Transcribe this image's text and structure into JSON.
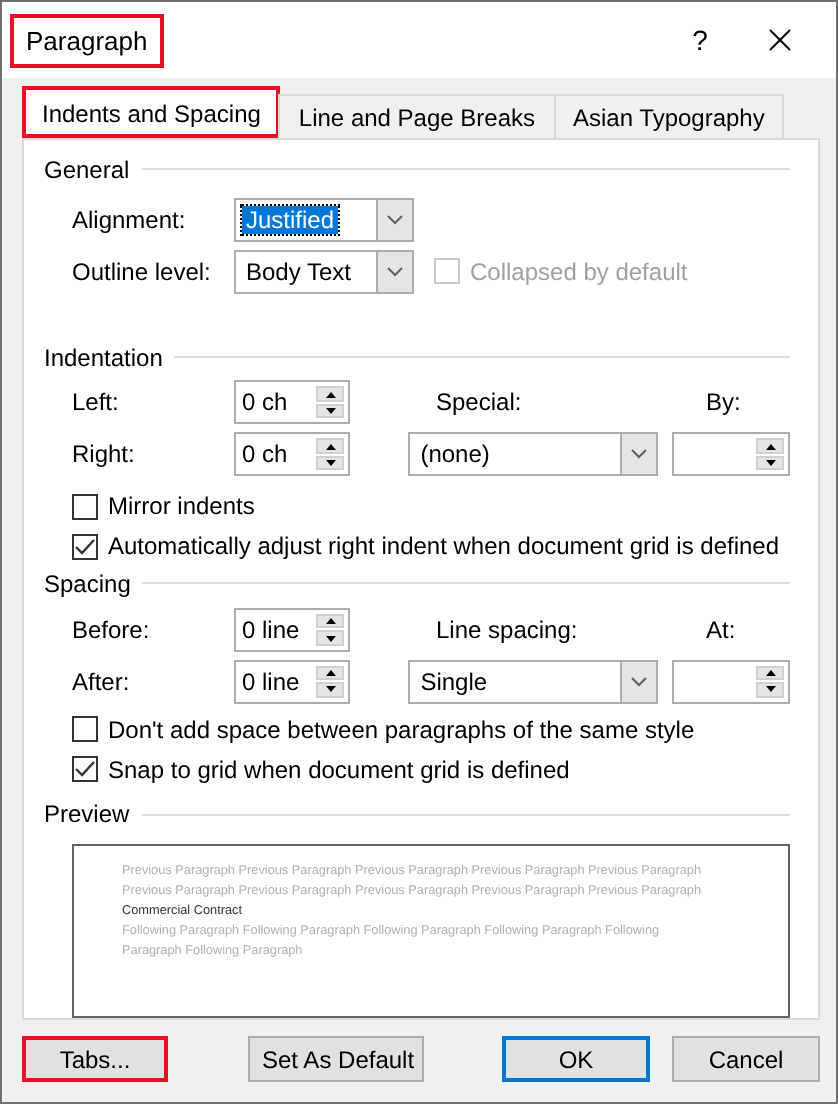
{
  "window": {
    "title": "Paragraph",
    "title_highlighted": true,
    "help": "?"
  },
  "tabs": [
    {
      "label": "Indents and Spacing",
      "selected": true,
      "highlighted": true
    },
    {
      "label": "Line and Page Breaks",
      "selected": false,
      "highlighted": false
    },
    {
      "label": "Asian Typography",
      "selected": false,
      "highlighted": false
    }
  ],
  "general": {
    "heading": "General",
    "alignment": {
      "label": "Alignment:",
      "value": "Justified",
      "focused": true
    },
    "outline_level": {
      "label": "Outline level:",
      "value": "Body Text"
    },
    "collapsed": {
      "label": "Collapsed by default",
      "checked": false,
      "disabled": true
    }
  },
  "indentation": {
    "heading": "Indentation",
    "left": {
      "label": "Left:",
      "value": "0 ch"
    },
    "right": {
      "label": "Right:",
      "value": "0 ch"
    },
    "special": {
      "label": "Special:",
      "value": "(none)"
    },
    "by": {
      "label": "By:"
    },
    "checkboxes": [
      {
        "label": "Mirror indents",
        "checked": false
      },
      {
        "label": "Automatically adjust right indent when document grid is defined",
        "checked": true
      }
    ]
  },
  "spacing": {
    "heading": "Spacing",
    "before": {
      "label": "Before:",
      "value": "0 line"
    },
    "after": {
      "label": "After:",
      "value": "0 line"
    },
    "line_spacing": {
      "label": "Line spacing:",
      "value": "Single"
    },
    "at": {
      "label": "At:"
    },
    "checkboxes": [
      {
        "label": "Don't add space between paragraphs of the same style",
        "checked": false
      },
      {
        "label": "Snap to grid when document grid is defined",
        "checked": true
      }
    ]
  },
  "preview": {
    "heading": "Preview",
    "previous": "Previous Paragraph Previous Paragraph Previous Paragraph Previous Paragraph Previous Paragraph Previous Paragraph Previous Paragraph Previous Paragraph Previous Paragraph Previous Paragraph",
    "current": "Commercial Contract",
    "following": "Following Paragraph Following Paragraph Following Paragraph Following Paragraph Following Paragraph Following Paragraph"
  },
  "buttons": [
    {
      "label": "Tabs...",
      "kind": "left",
      "highlighted": true,
      "default": false
    },
    {
      "label": "Set As Default",
      "kind": "left",
      "highlighted": false,
      "default": false
    },
    {
      "label": "OK",
      "kind": "right",
      "highlighted": false,
      "default": true
    },
    {
      "label": "Cancel",
      "kind": "right",
      "highlighted": false,
      "default": false
    }
  ]
}
